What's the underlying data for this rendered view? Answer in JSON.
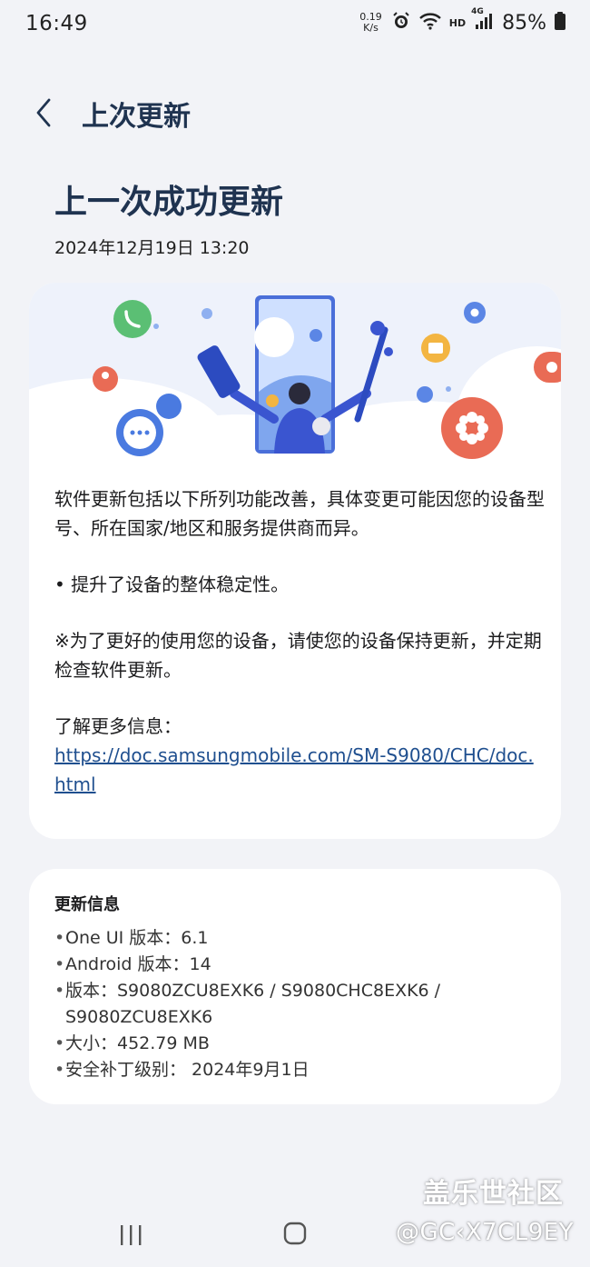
{
  "status_bar": {
    "time": "16:49",
    "net_speed_value": "0.19",
    "net_speed_unit": "K/s",
    "hd": "HD",
    "network": "4G",
    "battery": "85%",
    "icons": [
      "alarm-icon",
      "wifi-icon",
      "signal-icon",
      "battery-icon"
    ]
  },
  "header": {
    "title": "上次更新"
  },
  "page": {
    "title": "上一次成功更新",
    "date": "2024年12月19日 13:20"
  },
  "update_notes": {
    "paragraph1": "软件更新包括以下所列功能改善，具体变更可能因您的设备型号、所在国家/地区和服务提供商而异。",
    "bullet1": "• 提升了设备的整体稳定性。",
    "note": "※为了更好的使用您的设备，请使您的设备保持更新，并定期检查软件更新。",
    "more_info_label": "了解更多信息：",
    "more_info_link": "https://doc.samsungmobile.com/SM-S9080/CHC/doc.html"
  },
  "update_info": {
    "title": "更新信息",
    "items": [
      "One UI 版本：6.1",
      "Android 版本：14",
      "版本：S9080ZCU8EXK6 / S9080CHC8EXK6 / S9080ZCU8EXK6",
      "大小：452.79 MB",
      "安全补丁级别： 2024年9月1日"
    ]
  },
  "watermark": {
    "text": "盖乐世社区",
    "user": "@GC‹X7CL9EY"
  },
  "colors": {
    "background": "#f2f3f7",
    "title": "#1f3350",
    "link": "#1f4f8f",
    "card": "#ffffff"
  }
}
